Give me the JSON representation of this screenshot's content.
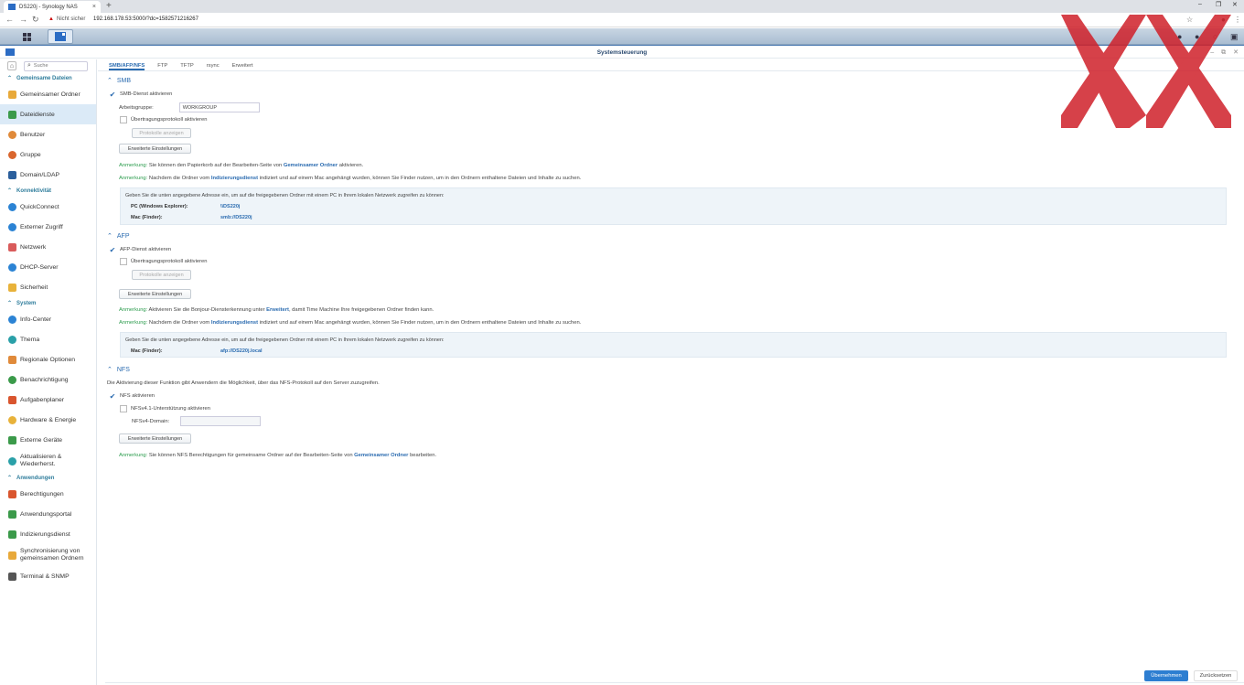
{
  "browser": {
    "tab_title": "DS220j - Synology NAS",
    "tab_close": "×",
    "new_tab": "+",
    "security_label": "Nicht sicher",
    "url": "192.168.178.53:5000/?dc=1582571216267",
    "controls": {
      "min": "–",
      "max": "❐",
      "close": "✕"
    }
  },
  "window": {
    "title": "Systemsteuerung",
    "controls": [
      "–",
      "⧉",
      "✕"
    ]
  },
  "sidebar": {
    "search_placeholder": "Suche",
    "sections": [
      {
        "label": "Gemeinsame Dateien"
      },
      {
        "label": "Konnektivität"
      },
      {
        "label": "System"
      },
      {
        "label": "Anwendungen"
      }
    ],
    "items": [
      {
        "label": "Gemeinsamer Ordner",
        "color": "#e8a93a"
      },
      {
        "label": "Dateidienste",
        "color": "#3b9a4a"
      },
      {
        "label": "Benutzer",
        "color": "#e08a3a"
      },
      {
        "label": "Gruppe",
        "color": "#d9662e"
      },
      {
        "label": "Domain/LDAP",
        "color": "#2b5f9c"
      },
      {
        "label": "QuickConnect",
        "color": "#2b83d4"
      },
      {
        "label": "Externer Zugriff",
        "color": "#2b83d4"
      },
      {
        "label": "Netzwerk",
        "color": "#d95b5b"
      },
      {
        "label": "DHCP-Server",
        "color": "#2b83d4"
      },
      {
        "label": "Sicherheit",
        "color": "#e8b23a"
      },
      {
        "label": "Info-Center",
        "color": "#2b83d4"
      },
      {
        "label": "Thema",
        "color": "#2aa0a8"
      },
      {
        "label": "Regionale Optionen",
        "color": "#e08a3a"
      },
      {
        "label": "Benachrichtigung",
        "color": "#3b9a4a"
      },
      {
        "label": "Aufgabenplaner",
        "color": "#d9552e"
      },
      {
        "label": "Hardware & Energie",
        "color": "#e8b23a"
      },
      {
        "label": "Externe Geräte",
        "color": "#3b9a4a"
      },
      {
        "label": "Aktualisieren & Wiederherst.",
        "color": "#2aa0a8"
      },
      {
        "label": "Berechtigungen",
        "color": "#d9552e"
      },
      {
        "label": "Anwendungsportal",
        "color": "#3b9a4a"
      },
      {
        "label": "Indizierungsdienst",
        "color": "#3b9a4a"
      },
      {
        "label": "Synchronisierung von gemeinsamen Ordnern",
        "color": "#e8a93a"
      },
      {
        "label": "Terminal & SNMP",
        "color": "#555555"
      }
    ]
  },
  "tabs": [
    "SMB/AFP/NFS",
    "FTP",
    "TFTP",
    "rsync",
    "Erweitert"
  ],
  "smb": {
    "heading": "SMB",
    "enable": "SMB-Dienst aktivieren",
    "workgroup_label": "Arbeitsgruppe:",
    "workgroup_value": "WORKGROUP",
    "log_enable": "Übertragungsprotokoll aktivieren",
    "show_logs": "Protokolle anzeigen",
    "advanced": "Erweiterte Einstellungen",
    "note_label": "Anmerkung:",
    "note1_a": " Sie können den Papierkorb auf der Bearbeiten-Seite von ",
    "note1_link": "Gemeinsamer Ordner",
    "note1_b": " aktivieren.",
    "note2_a": " Nachdem die Ordner vom ",
    "note2_link": "Indizierungsdienst",
    "note2_b": " indiziert und auf einem Mac angehängt wurden, können Sie Finder nutzen, um in den Ordnern enthaltene Dateien und Inhalte zu suchen.",
    "info_text": "Geben Sie die unten angegebene Adresse ein, um auf die freigegebenen Ordner mit einem PC in Ihrem lokalen Netzwerk zugreifen zu können:",
    "pc_label": "PC (Windows Explorer):",
    "pc_value": "\\\\DS220j",
    "mac_label": "Mac (Finder):",
    "mac_value": "smb://DS220j"
  },
  "afp": {
    "heading": "AFP",
    "enable": "AFP-Dienst aktivieren",
    "log_enable": "Übertragungsprotokoll aktivieren",
    "show_logs": "Protokolle anzeigen",
    "advanced": "Erweiterte Einstellungen",
    "note_label": "Anmerkung:",
    "note1_a": " Aktivieren Sie die Bonjour-Diensterkennung unter ",
    "note1_link": "Erweitert",
    "note1_b": ", damit Time Machine Ihre freigegebenen Ordner finden kann.",
    "note2_a": " Nachdem die Ordner vom ",
    "note2_link": "Indizierungsdienst",
    "note2_b": " indiziert und auf einem Mac angehängt wurden, können Sie Finder nutzen, um in den Ordnern enthaltene Dateien und Inhalte zu suchen.",
    "info_text": "Geben Sie die unten angegebene Adresse ein, um auf die freigegebenen Ordner mit einem PC in Ihrem lokalen Netzwerk zugreifen zu können:",
    "mac_label": "Mac (Finder):",
    "mac_value": "afp://DS220j.local"
  },
  "nfs": {
    "heading": "NFS",
    "description": "Die Aktivierung dieser Funktion gibt Anwendern die Möglichkeit, über das NFS-Protokoll auf den Server zuzugreifen.",
    "enable": "NFS aktivieren",
    "v41_enable": "NFSv4.1-Unterstützung aktivieren",
    "domain_label": "NFSv4-Domain:",
    "domain_value": "",
    "advanced": "Erweiterte Einstellungen",
    "note_label": "Anmerkung:",
    "note_a": " Sie können NFS Berechtigungen für gemeinsame Ordner auf der Bearbeiten-Seite von ",
    "note_link": "Gemeinsamer Ordner",
    "note_b": " bearbeiten."
  },
  "footer": {
    "apply": "Übernehmen",
    "reset": "Zurücksetzen"
  },
  "accent": "#2a6bb0",
  "overlay_color": "#d0202a"
}
